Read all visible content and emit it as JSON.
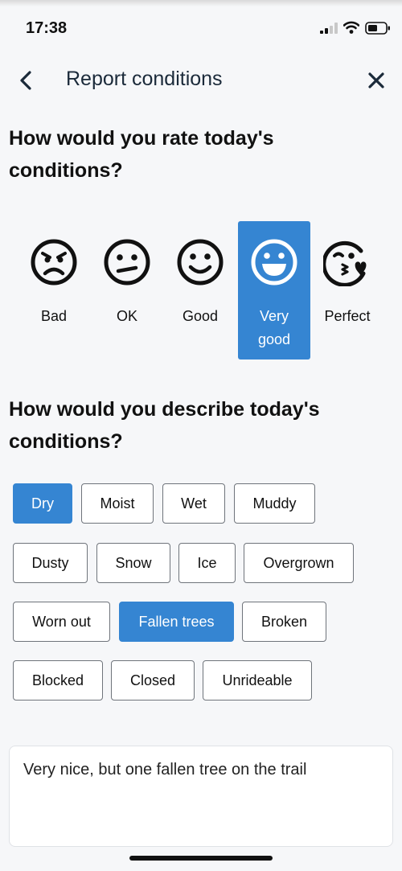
{
  "status_bar": {
    "time": "17:38"
  },
  "nav": {
    "title": "Report conditions"
  },
  "rating": {
    "question": "How would you rate today's conditions?",
    "options": [
      {
        "label": "Bad",
        "icon": "frown-face-icon"
      },
      {
        "label": "OK",
        "icon": "meh-face-icon"
      },
      {
        "label": "Good",
        "icon": "smile-face-icon"
      },
      {
        "label": "Very good",
        "icon": "grin-face-icon",
        "selected": true
      },
      {
        "label": "Perfect",
        "icon": "kiss-heart-face-icon"
      }
    ]
  },
  "conditions": {
    "question": "How would you describe today's conditions?",
    "chips": [
      {
        "label": "Dry",
        "selected": true
      },
      {
        "label": "Moist"
      },
      {
        "label": "Wet"
      },
      {
        "label": "Muddy"
      },
      {
        "label": "Dusty"
      },
      {
        "label": "Snow"
      },
      {
        "label": "Ice"
      },
      {
        "label": "Overgrown"
      },
      {
        "label": "Worn out"
      },
      {
        "label": "Fallen trees",
        "selected": true
      },
      {
        "label": "Broken"
      },
      {
        "label": "Blocked"
      },
      {
        "label": "Closed"
      },
      {
        "label": "Unrideable"
      }
    ]
  },
  "comment": {
    "value": "Very nice, but one fallen tree on the trail"
  },
  "colors": {
    "accent": "#3585d2",
    "background": "#f6f7f9"
  }
}
